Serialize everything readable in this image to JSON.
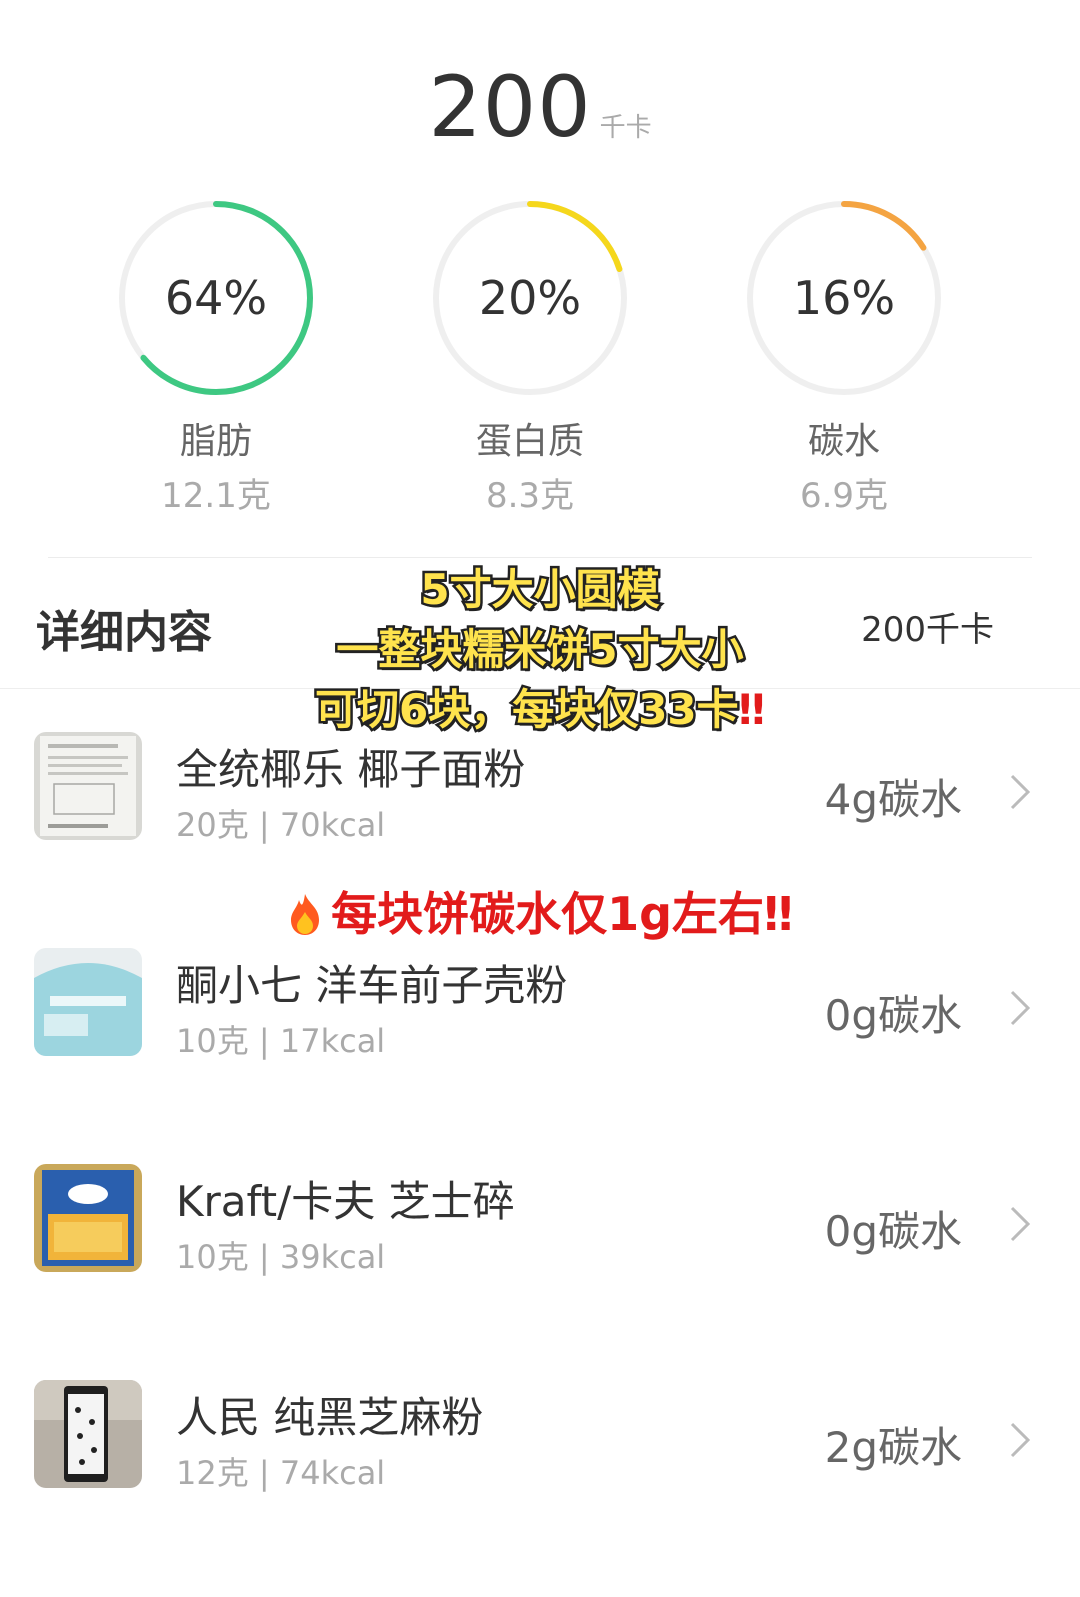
{
  "total": {
    "value": "200",
    "unit": "千卡"
  },
  "macros": [
    {
      "percent": "64%",
      "fraction": 0.64,
      "name": "脂肪",
      "grams": "12.1克",
      "color": "#3ec882"
    },
    {
      "percent": "20%",
      "fraction": 0.2,
      "name": "蛋白质",
      "grams": "8.3克",
      "color": "#f5d71c"
    },
    {
      "percent": "16%",
      "fraction": 0.16,
      "name": "碳水",
      "grams": "6.9克",
      "color": "#f4a442"
    }
  ],
  "details": {
    "title": "详细内容",
    "kcal": "200千卡"
  },
  "overlay": {
    "line1": "5寸大小圆模",
    "line2": "一整块糯米饼5寸大小",
    "line3": "可切6块，每块仅33卡",
    "line3_mark": "‼"
  },
  "note": {
    "text": "每块饼碳水仅1g左右",
    "mark": "‼",
    "icon": "fire-icon"
  },
  "items": [
    {
      "name": "全统椰乐 椰子面粉",
      "sub": "20克 | 70kcal",
      "carb": "4g碳水"
    },
    {
      "name": "酮小七 洋车前子壳粉",
      "sub": "10克 | 17kcal",
      "carb": "0g碳水"
    },
    {
      "name": "Kraft/卡夫 芝士碎",
      "sub": "10克 | 39kcal",
      "carb": "0g碳水"
    },
    {
      "name": "人民 纯黑芝麻粉",
      "sub": "12克 | 74kcal",
      "carb": "2g碳水"
    }
  ],
  "colors": {
    "track": "#efefef",
    "overlay_fill": "#ffe34d",
    "alert": "#e21b1b"
  }
}
